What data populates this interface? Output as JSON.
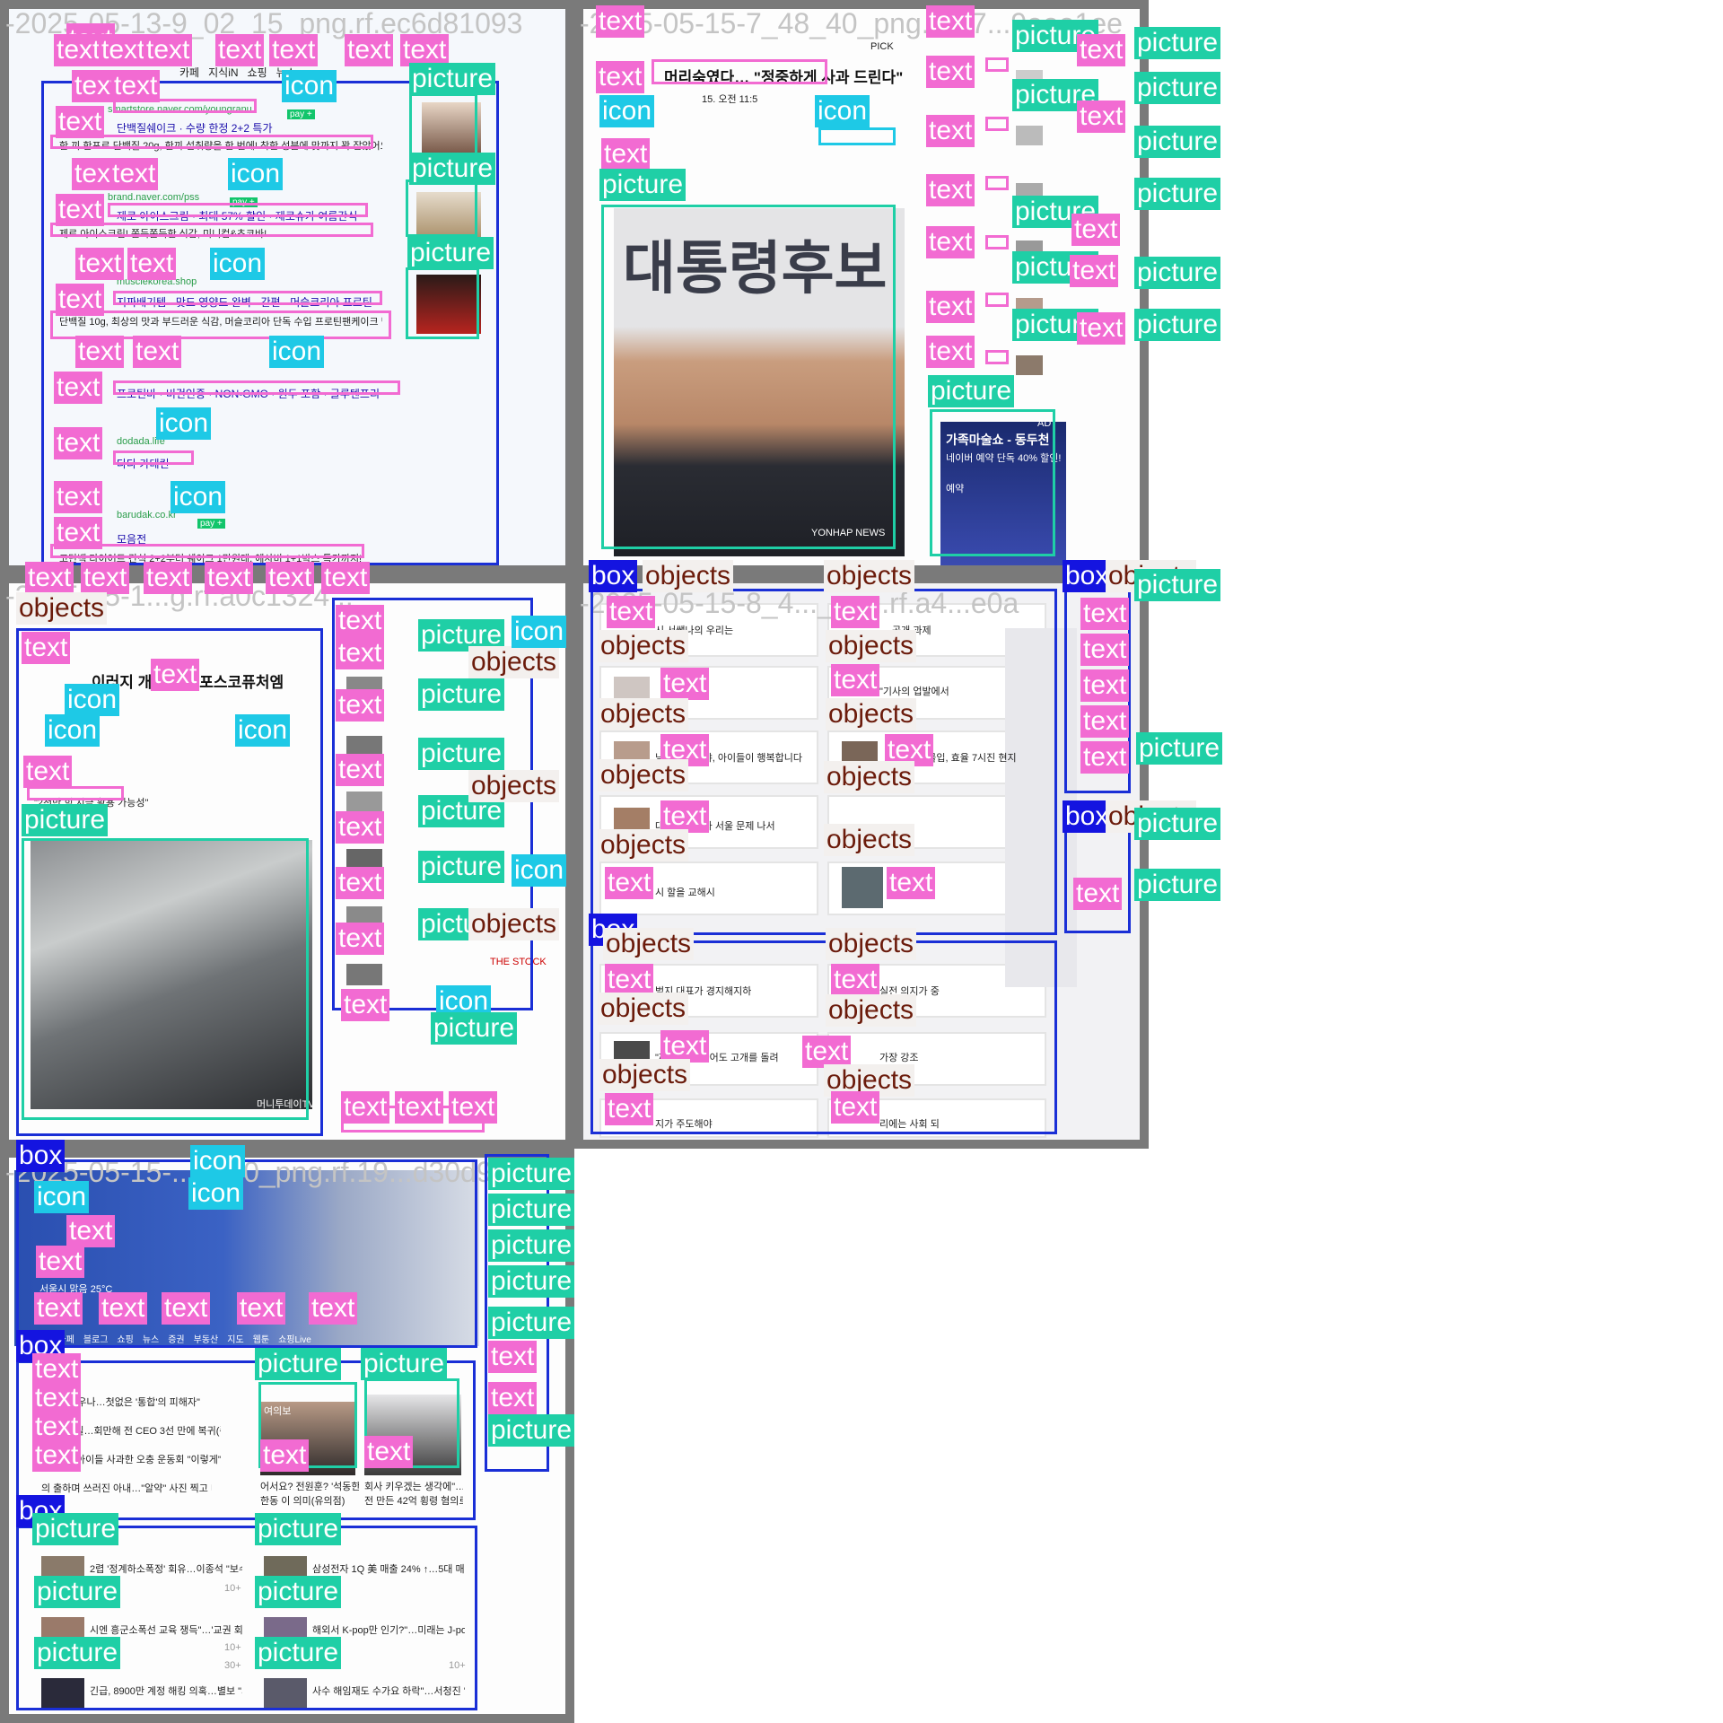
{
  "tiles": {
    "a": {
      "filename": "-2025-05-13-9_02_15_png.rf.ec6d81093"
    },
    "b": {
      "filename": "-2025-05-15-7_48_40_png.rf.57...9eee1ee"
    },
    "c": {
      "filename": "-2025-05-1...g.rf.a0c1324..."
    },
    "d": {
      "filename": "-2025-05-15-8_4..._png.rf.a4...e0a"
    },
    "e": {
      "filename": "-2025-05-15-...3_30_png.rf.19...d30d9"
    }
  },
  "labels": {
    "text": "text",
    "icon": "icon",
    "picture": "picture",
    "objects": "objects",
    "box": "box"
  },
  "shop": {
    "nav": [
      "카페",
      "지식iN",
      "쇼핑",
      "뉴스"
    ],
    "ads": [
      {
        "url": "smartstore.naver.com/youngranu",
        "title": "단백질쉐이크 · 수량 한정 2+2 특가",
        "desc": "한 끼 한포로 단백질 20g, 한끼 섭취량을 한 번에! 착한 성분에 맛까지 꽉 잡았어요",
        "pay": "pay +"
      },
      {
        "url": "brand.naver.com/pss",
        "title": "제로 아이스크림 · 최대 57% 할인 · 제로슈가 여름간식",
        "desc": "제로 아이스크림! 쫀득쫀득한 식감, 미니컵&초코바!",
        "pay": "pay +"
      },
      {
        "url": "musclekorea.shop",
        "title": "지짜배기템 · 맛도 영양도 완벽 · 간편 · 머슬코리아 프로틴",
        "desc": "단백질 10g, 최상의 맛과 부드러운 식감, 머슬코리아 단독 수입 프로틴팬케이크 맛",
        "pay": "pay +"
      },
      {
        "url": "",
        "title": "프로틴바 · 비건인증 · NON-GMO · 원두 포함 · 글루텐프리",
        "desc": "",
        "pay": ""
      },
      {
        "url": "dodada.life",
        "title": "다다 카테킨",
        "desc": "",
        "pay": ""
      },
      {
        "url": "barudak.co.kr",
        "title": "모음전",
        "desc": "고단백 다이어트 간식 2+2부터 쉐이크 1만원대, 에사비 1+1박스 특가까지!",
        "pay": "pay +"
      }
    ]
  },
  "news": {
    "pick": "PICK",
    "headline": "머리숙였다… \"정중하게 사과 드린다\"",
    "time": "15. 오전 11:5",
    "hero_caption": "대통령후보",
    "photo_credit": "YONHAP NEWS",
    "ad_title": "가족마술쇼 - 동두천",
    "ad_sub": "네이버 예약 단독 40% 할인!",
    "ad_badge": "예약",
    "ad_tag": "AD"
  },
  "press": {
    "headline": "이러지 개미…장 포스코퓨처엠",
    "caption": "\"2천만 힘 지금 활용 가능성\"",
    "tv_credit": "머니투데이TV",
    "stock": "THE STOCK"
  },
  "feed": {
    "rows": [
      {
        "left": "시 서쌤나의 우리는",
        "right": "… 공개 과제"
      },
      {
        "left": "",
        "right": "\"기사의 업발에서"
      },
      {
        "left": "님이 행복해야, 아이들이 행복합니다",
        "right": "앞으 몰입, 효율 7시진 현지"
      },
      {
        "left": "대추 통과했다 서울 문제 나서",
        "right": ""
      },
      {
        "left": "시 할을 교해시",
        "right": ""
      },
      {
        "left": "범지 대표가 경지해지하",
        "right": "실전 의지가 중"
      },
      {
        "left": "\"깨져 지난 들어도 고개를 돌려",
        "right": "가장 강조"
      },
      {
        "left": "지가 주도해야",
        "right": "리에는 사회 되"
      }
    ]
  },
  "portal": {
    "weather": "서울시 맑음 25°C",
    "menu": [
      "메일",
      "카페",
      "블로그",
      "쇼핑",
      "뉴스",
      "증권",
      "부동산",
      "지도",
      "웹툰",
      "쇼핑Live"
    ],
    "news": [
      "\"도 왜 싸우나…첫없은 '통합'의 피해자\"",
      "\"부모 산실…회만해 전 CEO 3선 만에 복귀(종합)",
      "\"사다\"…아이들 사과한 오충 운동회 \"이렇게\"",
      "의 출하며 쓰러진 아내…\"알약\" 사진 찍고 테니스 간 남편"
    ],
    "cards": [
      {
        "badge": "여의보",
        "caption": "어서요? 전원훈? '석동한 김은수 협조",
        "sub": "한동 이 의미(유의점)"
      },
      {
        "badge": "",
        "caption": "회사 키우겠는 생각에\"…화방을,",
        "sub": "전 만든 42억 횡령 혐의로 재수"
      }
    ],
    "list": [
      {
        "title": "2렵 '정계하소폭정' 회유…이종석 \"보수 진영 절단 내놓고",
        "count": "10+"
      },
      {
        "title": "삼성전자 1Q 美 매출 24% ↑…5대 매출처 열퍼진 전망",
        "count": ""
      },
      {
        "title": "시엔 흥군소폭선 교육 쟁득\"…'교권 회복 회우선\" 전망",
        "count": "10+"
      },
      {
        "title": "해외서 K-pop만 인기?\"…미래는 J-pop도 된다",
        "count": ""
      },
      {
        "title": "긴급, 8900만 계정 해킹 의혹…별보 \"시스템 해킹 아니, 지",
        "count": "30+"
      },
      {
        "title": "사수 해임재도 수가요 하락\"…서청진 '인 한드 해제 보류'",
        "count": "10+"
      }
    ]
  },
  "colors": {
    "text_tag": "#f26bd2",
    "icon_tag": "#1ec9e6",
    "picture_tag": "#1fcfa6",
    "box_tag": "#1414e0",
    "objects_text": "#6b1b0b",
    "tile_border": "#7a7a7a",
    "portal_blue": "#2a4fb0"
  }
}
